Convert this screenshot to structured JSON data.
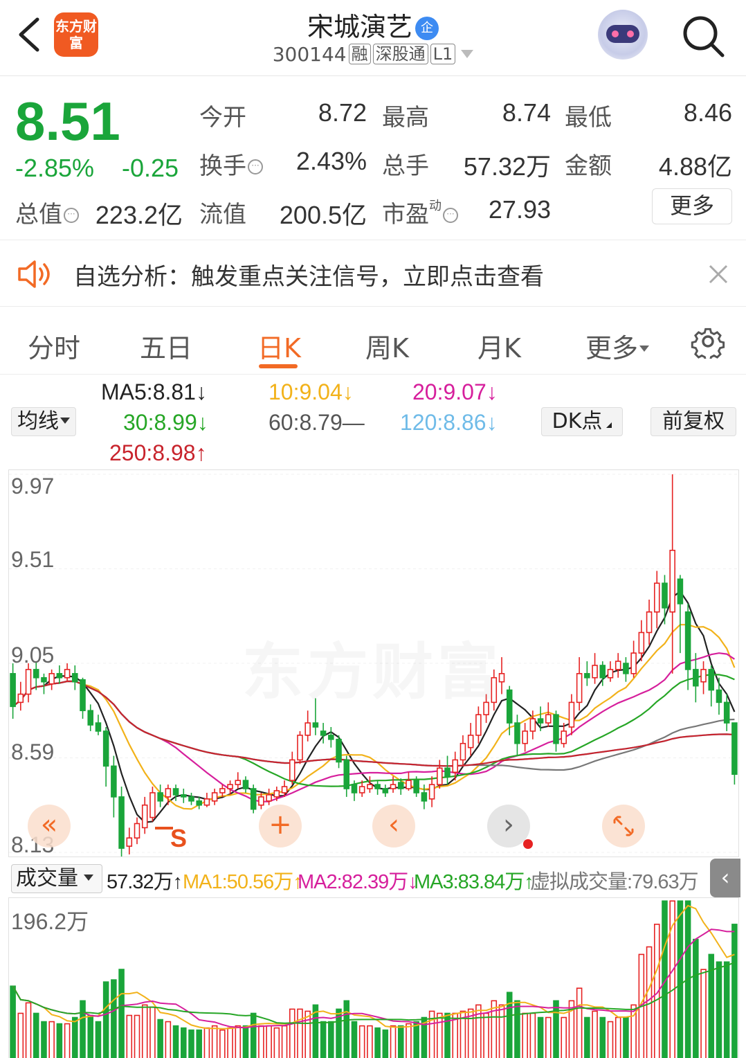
{
  "header": {
    "logo_text": "东方财富",
    "stock_name": "宋城演艺",
    "ent_badge": "企",
    "code": "300144",
    "tags": [
      "融",
      "深股通",
      "L1"
    ]
  },
  "quote": {
    "price": "8.51",
    "change_pct": "-2.85%",
    "change": "-0.25",
    "open_label": "今开",
    "open": "8.72",
    "high_label": "最高",
    "high": "8.74",
    "low_label": "最低",
    "low": "8.46",
    "turnover_label": "换手",
    "turnover": "2.43%",
    "volume_label": "总手",
    "volume": "57.32万",
    "amount_label": "金额",
    "amount": "4.88亿",
    "mktcap_label": "总值",
    "mktcap": "223.2亿",
    "float_label": "流值",
    "float": "200.5亿",
    "pe_label": "市盈",
    "pe_super": "动",
    "pe": "27.93",
    "more": "更多"
  },
  "alert": {
    "text": "自选分析：触发重点关注信号，立即点击查看"
  },
  "tabs": [
    "分时",
    "五日",
    "日K",
    "周K",
    "月K",
    "更多"
  ],
  "ma_panel": {
    "selector": "均线",
    "ma5": "MA5:8.81↓",
    "ma10": "10:9.04↓",
    "ma20": "20:9.07↓",
    "ma30": "30:8.99↓",
    "ma60": "60:8.79—",
    "ma120": "120:8.86↓",
    "ma250": "250:8.98↑",
    "dk_button": "DK点",
    "adjust_button": "前复权"
  },
  "colors": {
    "up": "#e62222",
    "down": "#1aa53a",
    "accent": "#f26a25",
    "ma5": "#222222",
    "ma10": "#f2b21a",
    "ma20": "#d61f9c",
    "ma30": "#26a626",
    "ma60": "#777777",
    "ma120": "#6fbbe8",
    "ma250": "#c8232c"
  },
  "chart_data": {
    "type": "candlestick",
    "y_ticks": [
      "9.97",
      "9.51",
      "9.05",
      "8.59",
      "8.13"
    ],
    "ylim": [
      8.13,
      9.97
    ],
    "candles": [
      [
        9.0,
        8.84,
        9.05,
        8.78
      ],
      [
        8.86,
        8.9,
        8.96,
        8.82
      ],
      [
        8.9,
        9.02,
        9.05,
        8.86
      ],
      [
        9.02,
        8.98,
        9.06,
        8.92
      ],
      [
        8.98,
        8.96,
        9.0,
        8.9
      ],
      [
        8.95,
        9.0,
        9.02,
        8.92
      ],
      [
        9.0,
        8.98,
        9.04,
        8.95
      ],
      [
        8.98,
        9.02,
        9.05,
        8.96
      ],
      [
        9.0,
        8.96,
        9.04,
        8.92
      ],
      [
        8.97,
        8.82,
        8.98,
        8.78
      ],
      [
        8.82,
        8.75,
        8.85,
        8.72
      ],
      [
        8.76,
        8.72,
        8.8,
        8.7
      ],
      [
        8.72,
        8.55,
        8.74,
        8.45
      ],
      [
        8.55,
        8.4,
        8.6,
        8.3
      ],
      [
        8.4,
        8.15,
        8.45,
        8.1
      ],
      [
        8.16,
        8.2,
        8.25,
        8.12
      ],
      [
        8.2,
        8.27,
        8.3,
        8.17
      ],
      [
        8.25,
        8.36,
        8.4,
        8.22
      ],
      [
        8.3,
        8.42,
        8.45,
        8.28
      ],
      [
        8.42,
        8.38,
        8.46,
        8.35
      ],
      [
        8.4,
        8.44,
        8.46,
        8.36
      ],
      [
        8.44,
        8.41,
        8.46,
        8.38
      ],
      [
        8.41,
        8.4,
        8.44,
        8.37
      ],
      [
        8.4,
        8.38,
        8.42,
        8.36
      ],
      [
        8.38,
        8.36,
        8.4,
        8.34
      ],
      [
        8.36,
        8.39,
        8.42,
        8.35
      ],
      [
        8.38,
        8.42,
        8.44,
        8.36
      ],
      [
        8.42,
        8.44,
        8.46,
        8.4
      ],
      [
        8.44,
        8.46,
        8.48,
        8.41
      ],
      [
        8.46,
        8.48,
        8.52,
        8.44
      ],
      [
        8.48,
        8.44,
        8.5,
        8.42
      ],
      [
        8.44,
        8.34,
        8.46,
        8.32
      ],
      [
        8.36,
        8.4,
        8.42,
        8.34
      ],
      [
        8.38,
        8.41,
        8.44,
        8.36
      ],
      [
        8.4,
        8.43,
        8.45,
        8.38
      ],
      [
        8.42,
        8.45,
        8.48,
        8.4
      ],
      [
        8.48,
        8.58,
        8.62,
        8.46
      ],
      [
        8.58,
        8.7,
        8.72,
        8.56
      ],
      [
        8.7,
        8.76,
        8.82,
        8.67
      ],
      [
        8.76,
        8.74,
        8.88,
        8.7
      ],
      [
        8.72,
        8.7,
        8.76,
        8.66
      ],
      [
        8.7,
        8.68,
        8.74,
        8.64
      ],
      [
        8.68,
        8.57,
        8.7,
        8.54
      ],
      [
        8.58,
        8.44,
        8.6,
        8.4
      ],
      [
        8.46,
        8.42,
        8.48,
        8.38
      ],
      [
        8.42,
        8.45,
        8.48,
        8.4
      ],
      [
        8.44,
        8.46,
        8.5,
        8.42
      ],
      [
        8.46,
        8.44,
        8.48,
        8.41
      ],
      [
        8.44,
        8.42,
        8.46,
        8.4
      ],
      [
        8.44,
        8.46,
        8.5,
        8.42
      ],
      [
        8.47,
        8.44,
        8.49,
        8.41
      ],
      [
        8.44,
        8.48,
        8.52,
        8.43
      ],
      [
        8.48,
        8.42,
        8.5,
        8.4
      ],
      [
        8.42,
        8.38,
        8.46,
        8.34
      ],
      [
        8.39,
        8.46,
        8.5,
        8.35
      ],
      [
        8.46,
        8.54,
        8.58,
        8.44
      ],
      [
        8.54,
        8.5,
        8.6,
        8.46
      ],
      [
        8.52,
        8.58,
        8.62,
        8.48
      ],
      [
        8.58,
        8.66,
        8.7,
        8.55
      ],
      [
        8.64,
        8.7,
        8.76,
        8.6
      ],
      [
        8.7,
        8.8,
        8.84,
        8.66
      ],
      [
        8.8,
        8.86,
        8.9,
        8.76
      ],
      [
        8.86,
        8.98,
        9.02,
        8.82
      ],
      [
        8.96,
        9.0,
        9.08,
        8.9
      ],
      [
        8.92,
        8.76,
        8.94,
        8.7
      ],
      [
        8.76,
        8.66,
        8.8,
        8.6
      ],
      [
        8.66,
        8.72,
        8.76,
        8.62
      ],
      [
        8.72,
        8.78,
        8.82,
        8.68
      ],
      [
        8.78,
        8.76,
        8.84,
        8.72
      ],
      [
        8.76,
        8.8,
        8.86,
        8.74
      ],
      [
        8.8,
        8.66,
        8.82,
        8.62
      ],
      [
        8.66,
        8.72,
        8.76,
        8.64
      ],
      [
        8.74,
        8.86,
        8.9,
        8.7
      ],
      [
        8.86,
        9.0,
        9.08,
        8.82
      ],
      [
        9.0,
        8.98,
        9.06,
        8.94
      ],
      [
        8.98,
        9.04,
        9.1,
        8.95
      ],
      [
        9.04,
        8.98,
        9.06,
        8.94
      ],
      [
        8.98,
        9.02,
        9.06,
        8.96
      ],
      [
        9.02,
        9.06,
        9.1,
        8.98
      ],
      [
        9.05,
        9.0,
        9.08,
        8.96
      ],
      [
        9.0,
        9.1,
        9.16,
        8.98
      ],
      [
        9.1,
        9.2,
        9.26,
        9.06
      ],
      [
        9.2,
        9.3,
        9.36,
        9.14
      ],
      [
        9.3,
        9.44,
        9.5,
        9.22
      ],
      [
        9.44,
        9.32,
        9.48,
        9.24
      ],
      [
        9.3,
        9.6,
        9.97,
        9.0
      ],
      [
        9.46,
        9.34,
        9.48,
        9.1
      ],
      [
        9.3,
        9.02,
        9.34,
        8.92
      ],
      [
        9.02,
        8.94,
        9.1,
        8.86
      ],
      [
        8.96,
        9.02,
        9.06,
        8.9
      ],
      [
        9.02,
        8.92,
        9.04,
        8.84
      ],
      [
        8.92,
        8.86,
        8.98,
        8.8
      ],
      [
        8.86,
        8.76,
        8.9,
        8.72
      ],
      [
        8.76,
        8.51,
        8.74,
        8.46
      ]
    ]
  },
  "volume_panel": {
    "selector": "成交量",
    "vol": "57.32万↑",
    "ma1": "MA1:50.56万↑",
    "ma2": "MA2:82.39万↓",
    "ma3": "MA3:83.84万↑",
    "virtual": "虚拟成交量:79.63万",
    "y_max": "196.2万"
  },
  "watermark": "东方财富"
}
